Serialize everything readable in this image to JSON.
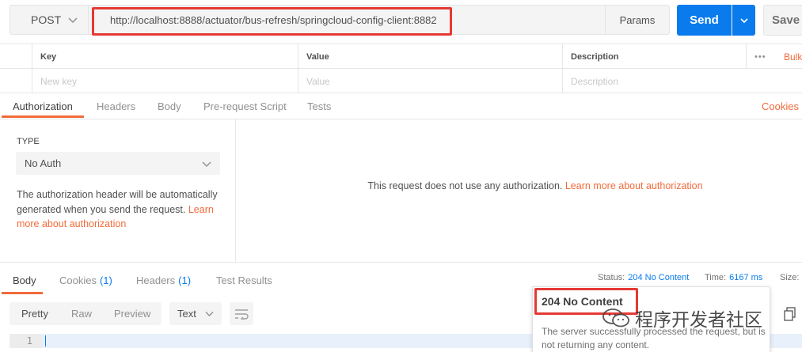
{
  "request": {
    "method": "POST",
    "url": "http://localhost:8888/actuator/bus-refresh/springcloud-config-client:8882",
    "params_label": "Params",
    "send_label": "Send",
    "save_label": "Save"
  },
  "params_table": {
    "headers": [
      "Key",
      "Value",
      "Description"
    ],
    "more_label": "•••",
    "bulk_label": "Bulk",
    "placeholders": [
      "New key",
      "Value",
      "Description"
    ]
  },
  "request_tabs": [
    "Authorization",
    "Headers",
    "Body",
    "Pre-request Script",
    "Tests"
  ],
  "cookies_label": "Cookies",
  "auth": {
    "type_label": "TYPE",
    "type_value": "No Auth",
    "desc": "The authorization header will be automatically generated when you send the request.",
    "desc_link": "Learn more about authorization",
    "message": "This request does not use any authorization.",
    "message_link": "Learn more about authorization"
  },
  "response": {
    "tabs": {
      "body": "Body",
      "cookies": "Cookies",
      "cookies_count": "(1)",
      "headers": "Headers",
      "headers_count": "(1)",
      "test_results": "Test Results"
    },
    "status_label": "Status:",
    "status_value": "204 No Content",
    "time_label": "Time:",
    "time_value": "6167 ms",
    "size_label": "Size:",
    "formats": [
      "Pretty",
      "Raw",
      "Preview"
    ],
    "text_select": "Text",
    "line_number": "1"
  },
  "tooltip": {
    "title": "204 No Content",
    "body": "The server successfully processed the request, but is not returning any content."
  },
  "watermark": "程序开发者社区",
  "colors": {
    "accent": "#f26b3a",
    "send": "#097bed",
    "highlight": "#e53935"
  }
}
